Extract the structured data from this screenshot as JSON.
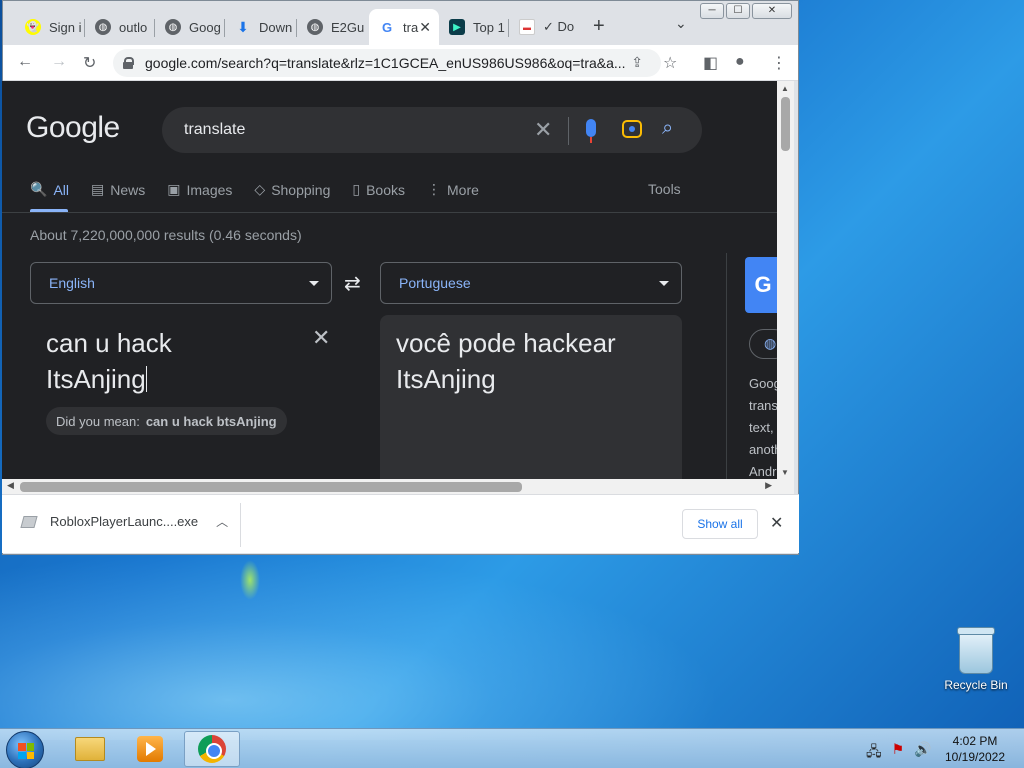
{
  "desktop": {
    "recycle_bin_label": "Recycle Bin"
  },
  "browser": {
    "tabs": [
      {
        "label": "Sign i",
        "icon": "snapchat-icon"
      },
      {
        "label": "outlo",
        "icon": "globe-icon"
      },
      {
        "label": "Goog",
        "icon": "globe-icon"
      },
      {
        "label": "Down",
        "icon": "download-icon"
      },
      {
        "label": "E2Gu",
        "icon": "globe-icon"
      },
      {
        "label": "tra",
        "icon": "google-icon",
        "active": true
      },
      {
        "label": "Top 1",
        "icon": "app-icon"
      },
      {
        "label": "✓ Do",
        "icon": "calendar-icon"
      }
    ],
    "new_tab_symbol": "+",
    "tab_close_symbol": "✕",
    "window_buttons": {
      "minimize": "─",
      "maximize": "☐",
      "close": "✕"
    },
    "url": "google.com/search?q=translate&rlz=1C1GCEA_enUS986US986&oq=tra&a..."
  },
  "google": {
    "logo": "Google",
    "query": "translate",
    "nav_tabs": [
      "All",
      "News",
      "Images",
      "Shopping",
      "Books",
      "More"
    ],
    "nav_icons": [
      "🔍",
      "▤",
      "▣",
      "◇",
      "▯",
      "⋮"
    ],
    "tools": "Tools",
    "result_stats": "About 7,220,000,000 results (0.46 seconds)",
    "translate": {
      "source_language": "English",
      "target_language": "Portuguese",
      "source_text_line1": "can u hack",
      "source_text_line2": "ItsAnjing",
      "did_you_mean_prefix": "Did you mean:",
      "did_you_mean_suggestion": "can u hack btsAnjing",
      "translated_text_line1": "você pode hackear",
      "translated_text_line2": "ItsAnjing"
    },
    "side_panel": {
      "logo_letter": "G",
      "text": "Goog\ntrans\ntext,\nanoth\nAndr"
    }
  },
  "downloads": {
    "filename": "RobloxPlayerLaunc....exe",
    "show_all": "Show all"
  },
  "taskbar": {
    "time": "4:02 PM",
    "date": "10/19/2022"
  }
}
